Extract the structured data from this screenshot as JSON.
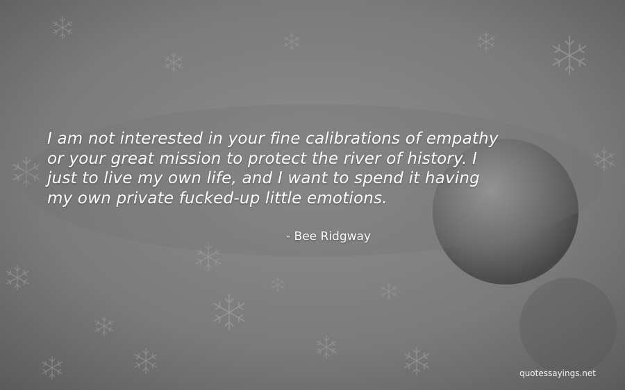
{
  "quote": {
    "lines": [
      "I am not interested in your fine calibrations of empathy",
      "or your great mission to protect the river of history. I",
      "just to live my own life, and I want to spend it having",
      "my own private fucked-up little emotions."
    ],
    "author": "- Bee Ridgway"
  },
  "watermark": "quotessayings.net",
  "colors": {
    "text": "#ffffff",
    "background": "#7d7d7d"
  }
}
